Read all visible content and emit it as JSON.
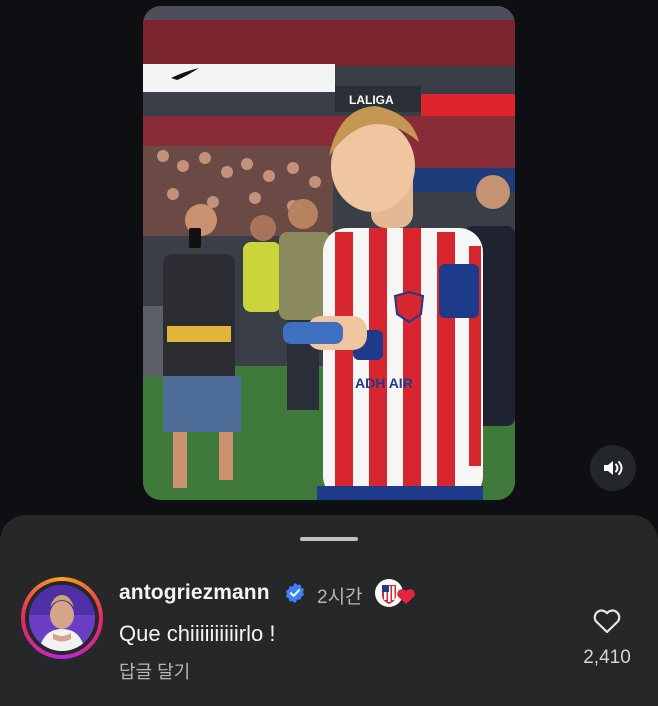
{
  "video": {
    "description_icon": "video-frame",
    "ad_board_text": "LALIGA",
    "sponsor_text": "ADH AIR"
  },
  "controls": {
    "mute_icon": "speaker-volume-icon"
  },
  "comment": {
    "username": "antogriezmann",
    "verified": true,
    "time": "2시간",
    "text": "Que chiiiiiiiiiirlo !",
    "reply_label": "답글 달기",
    "like_count": "2,410",
    "reaction_icons": [
      "atletico-badge-icon",
      "heart-icon"
    ]
  },
  "colors": {
    "background": "#0d0f12",
    "sheet": "#262729",
    "verified": "#3b82f6",
    "heart": "#e4243f",
    "atletico_red": "#d7262e"
  }
}
